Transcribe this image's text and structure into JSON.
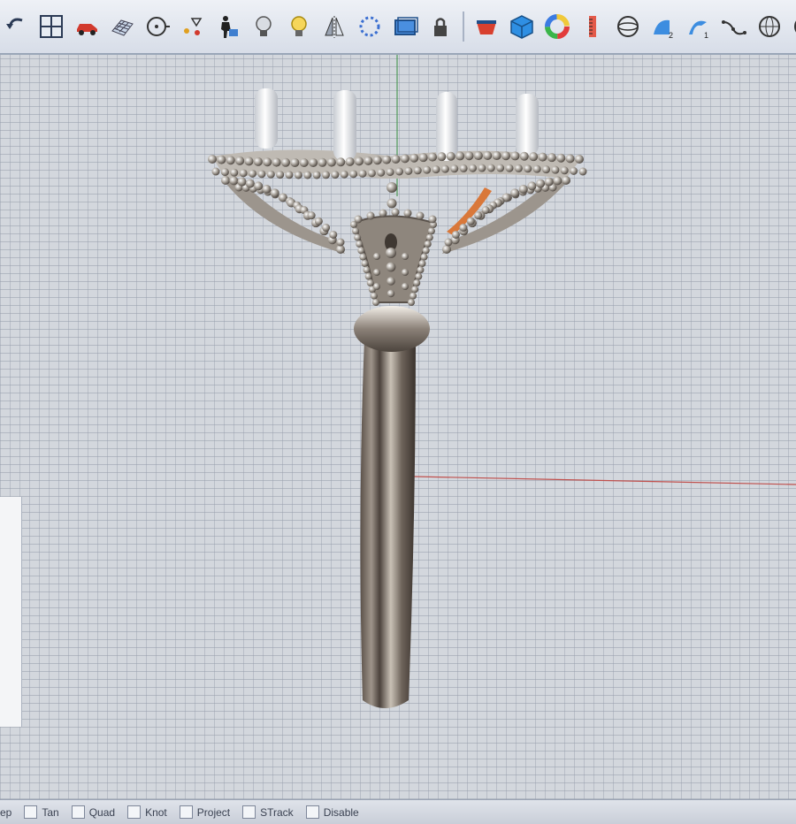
{
  "toolbar": {
    "icons": [
      "undo-arrow-icon",
      "four-viewports-icon",
      "car-icon",
      "mesh-grid-icon",
      "target-circle-icon",
      "points-move-icon",
      "worker-figure-icon",
      "light-bulb-icon",
      "spotlight-bulb-icon",
      "mirror-icon",
      "dotted-ring-icon",
      "layer-box-icon",
      "lock-icon",
      "red-material-icon",
      "blue-cube-icon",
      "color-wheel-icon",
      "ruler-icon",
      "sphere-half-icon",
      "surface-2-icon",
      "surface-1-icon",
      "curve-points-icon",
      "globe-grid-icon",
      "sphere-icon",
      "blue-sphere-icon"
    ]
  },
  "statusbar": {
    "snaps": [
      "Tan",
      "Quad",
      "Knot",
      "Project",
      "STrack",
      "Disable"
    ],
    "partial_left": "ep"
  },
  "colors": {
    "viewport_bg": "#d3d7dd",
    "metal": "#8a7f74",
    "highlight": "#f2efe9",
    "axis_red": "#c0504d",
    "axis_green": "#4f9a5a",
    "accent_orange": "#d9783a"
  }
}
